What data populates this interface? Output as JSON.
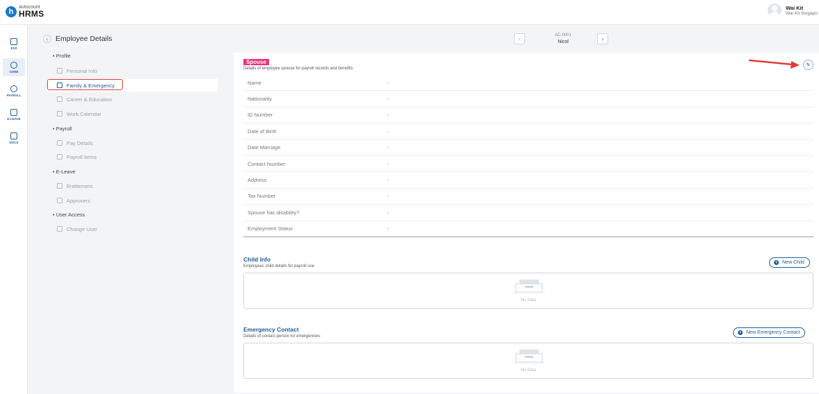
{
  "header": {
    "brand": "autocount",
    "product": "HRMS",
    "user_name": "Wai Kit",
    "user_company": "Wai Kit Singapo"
  },
  "rail": {
    "items": [
      {
        "label": "ESS",
        "icon": "ess-icon"
      },
      {
        "label": "CORE",
        "icon": "core-icon"
      },
      {
        "label": "PAYROLL",
        "icon": "payroll-icon"
      },
      {
        "label": "E-LEAVE",
        "icon": "calendar-icon"
      },
      {
        "label": "DOCS",
        "icon": "docs-icon"
      }
    ]
  },
  "subnav": {
    "title": "Employee Details",
    "groups": {
      "profile": "Profile",
      "payroll": "Payroll",
      "eleave": "E-Leave",
      "user_access": "User Access"
    },
    "items": {
      "personal_info": "Personal Info",
      "family_emergency": "Family & Emergency",
      "career_education": "Career & Education",
      "work_calendar": "Work Calendar",
      "pay_details": "Pay Details",
      "payroll_items": "Payroll Items",
      "entitlement": "Entitlement",
      "approvers": "Approvers",
      "change_user": "Change User"
    }
  },
  "pager": {
    "code": "AC-0001",
    "name": "Nicol"
  },
  "spouse": {
    "title": "Spouse",
    "description": "Details of employee spouse for payroll records and benefits",
    "fields": [
      {
        "label": "Name",
        "value": "-"
      },
      {
        "label": "Nationality",
        "value": "-"
      },
      {
        "label": "ID Number",
        "value": "-"
      },
      {
        "label": "Date of Birth",
        "value": "-"
      },
      {
        "label": "Date Marriage",
        "value": "-"
      },
      {
        "label": "Contact Number",
        "value": "-"
      },
      {
        "label": "Address",
        "value": "-"
      },
      {
        "label": "Tax Number",
        "value": "-"
      },
      {
        "label": "Spouse has disability?",
        "value": "-"
      },
      {
        "label": "Employment Status",
        "value": "-"
      }
    ]
  },
  "child": {
    "title": "Child Info",
    "description": "Employees child details for payroll use",
    "button": "New Child",
    "empty": "No Data"
  },
  "emergency": {
    "title": "Emergency Contact",
    "description": "Details of contact person for emergencies",
    "button": "New Emergency Contact",
    "empty": "No Data"
  },
  "colors": {
    "primary": "#1d5b9c",
    "highlight": "#f0307a",
    "annotation": "#e23b3b"
  }
}
